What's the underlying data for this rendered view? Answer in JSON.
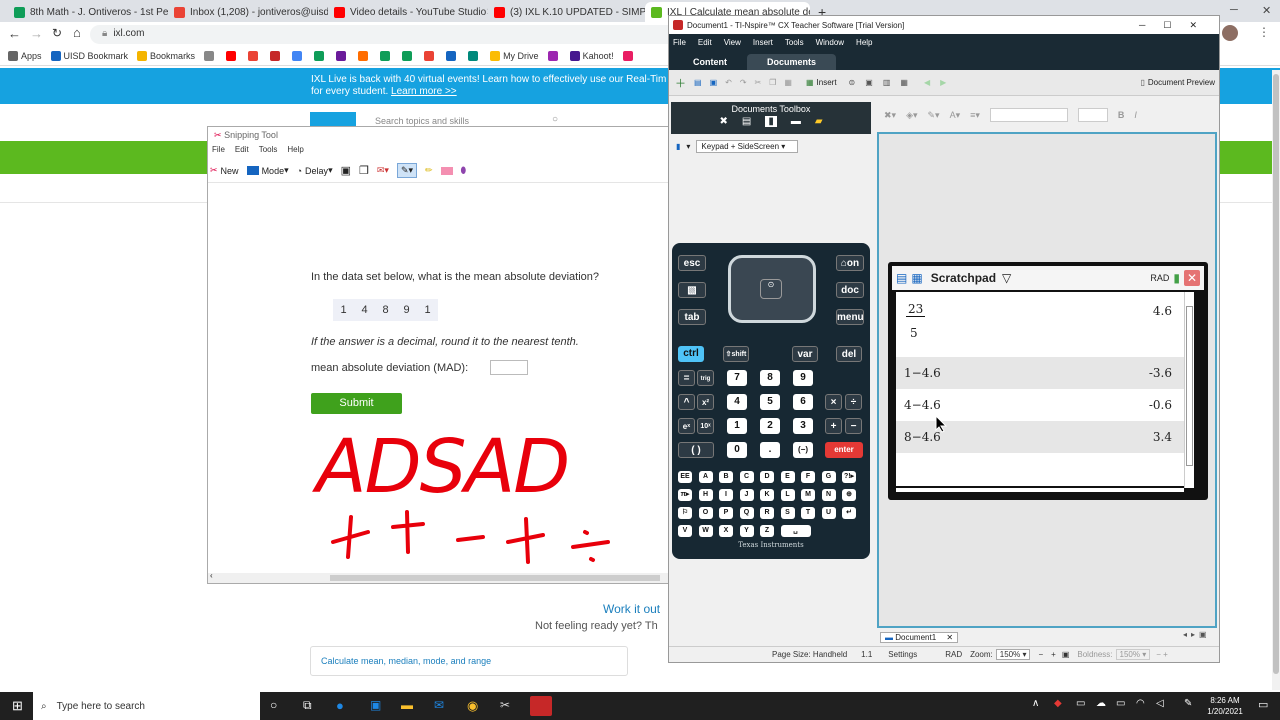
{
  "browser": {
    "tabs": [
      {
        "title": "8th Math - J. Ontiveros - 1st Peri",
        "color": "#0f9d58"
      },
      {
        "title": "Inbox (1,208) - jontiveros@uisd.n",
        "color": "#ea4335"
      },
      {
        "title": "Video details - YouTube Studio",
        "color": "#ff0000"
      },
      {
        "title": "(3) IXL K.10 UPDATED - SIMPLE IN",
        "color": "#ff0000"
      },
      {
        "title": "IXL | Calculate mean absolute de",
        "color": "#5cb91f"
      }
    ],
    "new_tab": "+",
    "url": "ixl.com",
    "bookmarks": [
      {
        "label": "Apps",
        "color": "#666"
      },
      {
        "label": "UISD Bookmark",
        "color": "#1565c0"
      },
      {
        "label": "Bookmarks",
        "color": "#f4b400"
      },
      {
        "label": "",
        "color": "#888"
      },
      {
        "label": "",
        "color": "#ff0000"
      },
      {
        "label": "",
        "color": "#ea4335"
      },
      {
        "label": "",
        "color": "#c62828"
      },
      {
        "label": "",
        "color": "#4285f4"
      },
      {
        "label": "",
        "color": "#0f9d58"
      },
      {
        "label": "",
        "color": "#6a1b9a"
      },
      {
        "label": "",
        "color": "#ff6d00"
      },
      {
        "label": "",
        "color": "#0f9d58"
      },
      {
        "label": "",
        "color": "#0f9d58"
      },
      {
        "label": "",
        "color": "#ea4335"
      },
      {
        "label": "",
        "color": "#1565c0"
      },
      {
        "label": "",
        "color": "#00897b"
      },
      {
        "label": "My Drive",
        "color": "#fbbc04"
      },
      {
        "label": "",
        "color": "#9c27b0"
      },
      {
        "label": "Kahoot!",
        "color": "#46178f"
      },
      {
        "label": "",
        "color": "#e91e63"
      }
    ]
  },
  "ixl": {
    "banner_line1": "IXL Live is back with 40 virtual events! Learn how to effectively use our Real-Tim",
    "banner_line2_prefix": "for every student.",
    "banner_link": "Learn more >>",
    "search_placeholder": "Search topics and skills",
    "work_it_out": "Work it out",
    "not_ready": "Not feeling ready yet? Th",
    "related_skill": "Calculate mean, median, mode, and range"
  },
  "snipping": {
    "title": "Snipping Tool",
    "menu": [
      "File",
      "Edit",
      "Tools",
      "Help"
    ],
    "tools": {
      "new": "New",
      "mode": "Mode",
      "delay": "Delay"
    },
    "question": "In the data set below, what is the mean absolute deviation?",
    "data_values": [
      "1",
      "4",
      "8",
      "9",
      "1"
    ],
    "instruction": "If the answer is a decimal, round it to the nearest tenth.",
    "answer_label": "mean absolute deviation (MAD):",
    "submit": "Submit",
    "handwriting": "ADSAD"
  },
  "tinspire": {
    "title": "Document1 - TI-Nspire™ CX Teacher Software [Trial Version]",
    "menu": [
      "File",
      "Edit",
      "View",
      "Insert",
      "Tools",
      "Window",
      "Help"
    ],
    "tabs": [
      "Content",
      "Documents"
    ],
    "toolbar_insert": "Insert",
    "document_preview": "Document Preview",
    "toolbox_title": "Documents Toolbox",
    "keypad_mode": "Keypad + SideScreen",
    "brand": "Texas Instruments",
    "scratchpad_title": "Scratchpad",
    "angle_mode": "RAD",
    "rows": [
      {
        "expr_num": "23",
        "expr_den": "5",
        "result": "4.6"
      },
      {
        "expr": "1−4.6",
        "result": "-3.6"
      },
      {
        "expr": "4−4.6",
        "result": "-0.6"
      },
      {
        "expr": "8−4.6",
        "result": "3.4"
      }
    ],
    "doc_tab": "Document1",
    "status": {
      "page_size": "Page Size: Handheld",
      "page": "1.1",
      "settings": "Settings",
      "angle": "RAD",
      "zoom_label": "Zoom:",
      "zoom": "150%",
      "boldness_label": "Boldness:",
      "boldness": "150%"
    }
  },
  "calc_keys": {
    "esc": "esc",
    "save": "save",
    "tab": "tab",
    "on": "on",
    "doc": "doc",
    "menu": "menu",
    "ctrl": "ctrl",
    "shift": "⇧shift",
    "var": "var",
    "del": "del",
    "eq": "=",
    "trig": "trig",
    "hat": "^",
    "sq": "x²",
    "ex": "eˣ",
    "tenx": "10ˣ",
    "paren": "( )",
    "n7": "7",
    "n8": "8",
    "n9": "9",
    "n4": "4",
    "n5": "5",
    "n6": "6",
    "n1": "1",
    "n2": "2",
    "n3": "3",
    "n0": "0",
    "dot": ".",
    "neg": "(−)",
    "times": "×",
    "div": "÷",
    "plus": "+",
    "minus": "−",
    "enter": "enter",
    "letters": [
      "EE",
      "A",
      "B",
      "C",
      "D",
      "E",
      "F",
      "G",
      "?!▸",
      "π▸",
      "H",
      "I",
      "J",
      "K",
      "L",
      "M",
      "N",
      "⊕",
      "⚐",
      "O",
      "P",
      "Q",
      "R",
      "S",
      "T",
      "U",
      "↵",
      "V",
      "W",
      "X",
      "Y",
      "Z",
      "␣"
    ]
  },
  "taskbar": {
    "search_placeholder": "Type here to search",
    "time": "8:26 AM",
    "date": "1/20/2021"
  }
}
